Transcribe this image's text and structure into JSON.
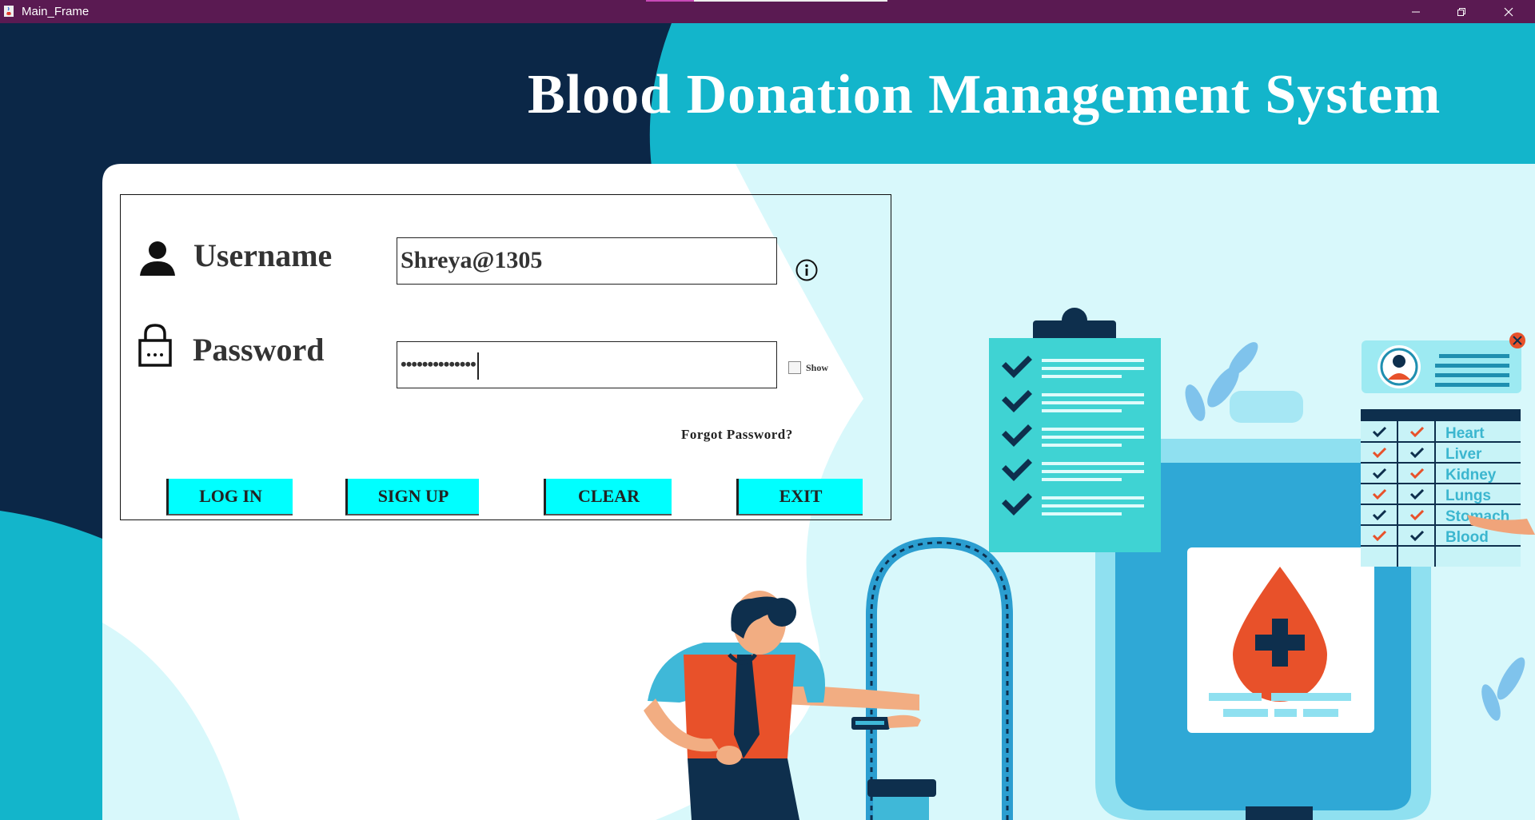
{
  "window": {
    "title": "Main_Frame"
  },
  "app": {
    "title": "Blood Donation Management System"
  },
  "login": {
    "username_label": "Username",
    "password_label": "Password",
    "username_value": "Shreya@1305",
    "password_value": "••••••••••••••",
    "show_label": "Show",
    "forgot_label": "Forgot Password?",
    "buttons": {
      "login": "LOG IN",
      "signup": "SIGN UP",
      "clear": "CLEAR",
      "exit": "EXIT"
    }
  },
  "illustration": {
    "organs": [
      "Heart",
      "Liver",
      "Kidney",
      "Lungs",
      "Stomach",
      "Blood"
    ]
  },
  "colors": {
    "titlebar": "#5a1a52",
    "dark_navy": "#0b2747",
    "teal": "#13b5cb",
    "button": "#00ffff",
    "blood_red": "#e8512a"
  }
}
